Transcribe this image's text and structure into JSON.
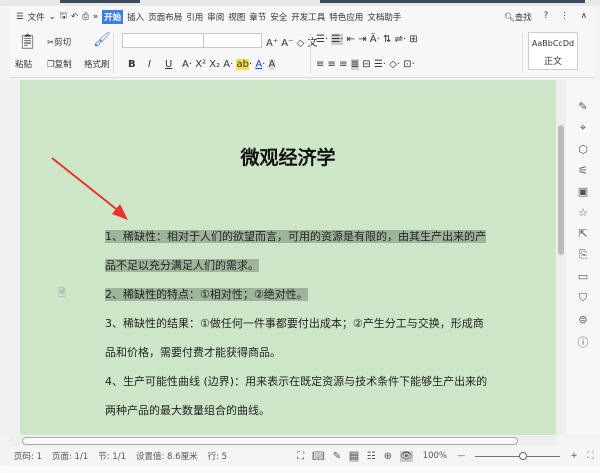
{
  "menu": {
    "file": "文件",
    "more": "»",
    "tabs": [
      "开始",
      "插入",
      "页面布局",
      "引用",
      "审阅",
      "视图",
      "章节",
      "安全",
      "开发工具",
      "特色应用",
      "文档助手"
    ],
    "active_tab": "开始",
    "search": "查找",
    "help": "?"
  },
  "toolbar": {
    "paste": "粘贴",
    "cut": "剪切",
    "copy": "复制",
    "format_painter": "格式刷",
    "bold": "B",
    "italic": "I",
    "underline": "U",
    "style_preview": "AaBbCcDd",
    "style_name": "正文"
  },
  "document": {
    "title": "微观经济学",
    "paragraphs": [
      "1、稀缺性：相对于人们的欲望而言，可用的资源是有限的，由其生产出来的产",
      "品不足以充分满足人们的需求。",
      "2、稀缺性的特点：①相对性；②绝对性。",
      "3、稀缺性的结果：①做任何一件事都要付出成本；②产生分工与交换，形成商",
      "品和价格，需要付费才能获得商品。",
      "4、生产可能性曲线 (边界)：用来表示在既定资源与技术条件下能够生产出来的",
      "两种产品的最大数量组合的曲线。"
    ],
    "background_color": "#cde6c8",
    "selection_color": "#9fb59b",
    "annotation_arrow_color": "#e8322b"
  },
  "status": {
    "page": "页码: 1",
    "pages": "页面: 1/1",
    "section": "节: 1/1",
    "setting": "设置值: 8.6厘米",
    "line": "行: 5",
    "zoom": "100%",
    "zoom_level_percent": 100
  }
}
